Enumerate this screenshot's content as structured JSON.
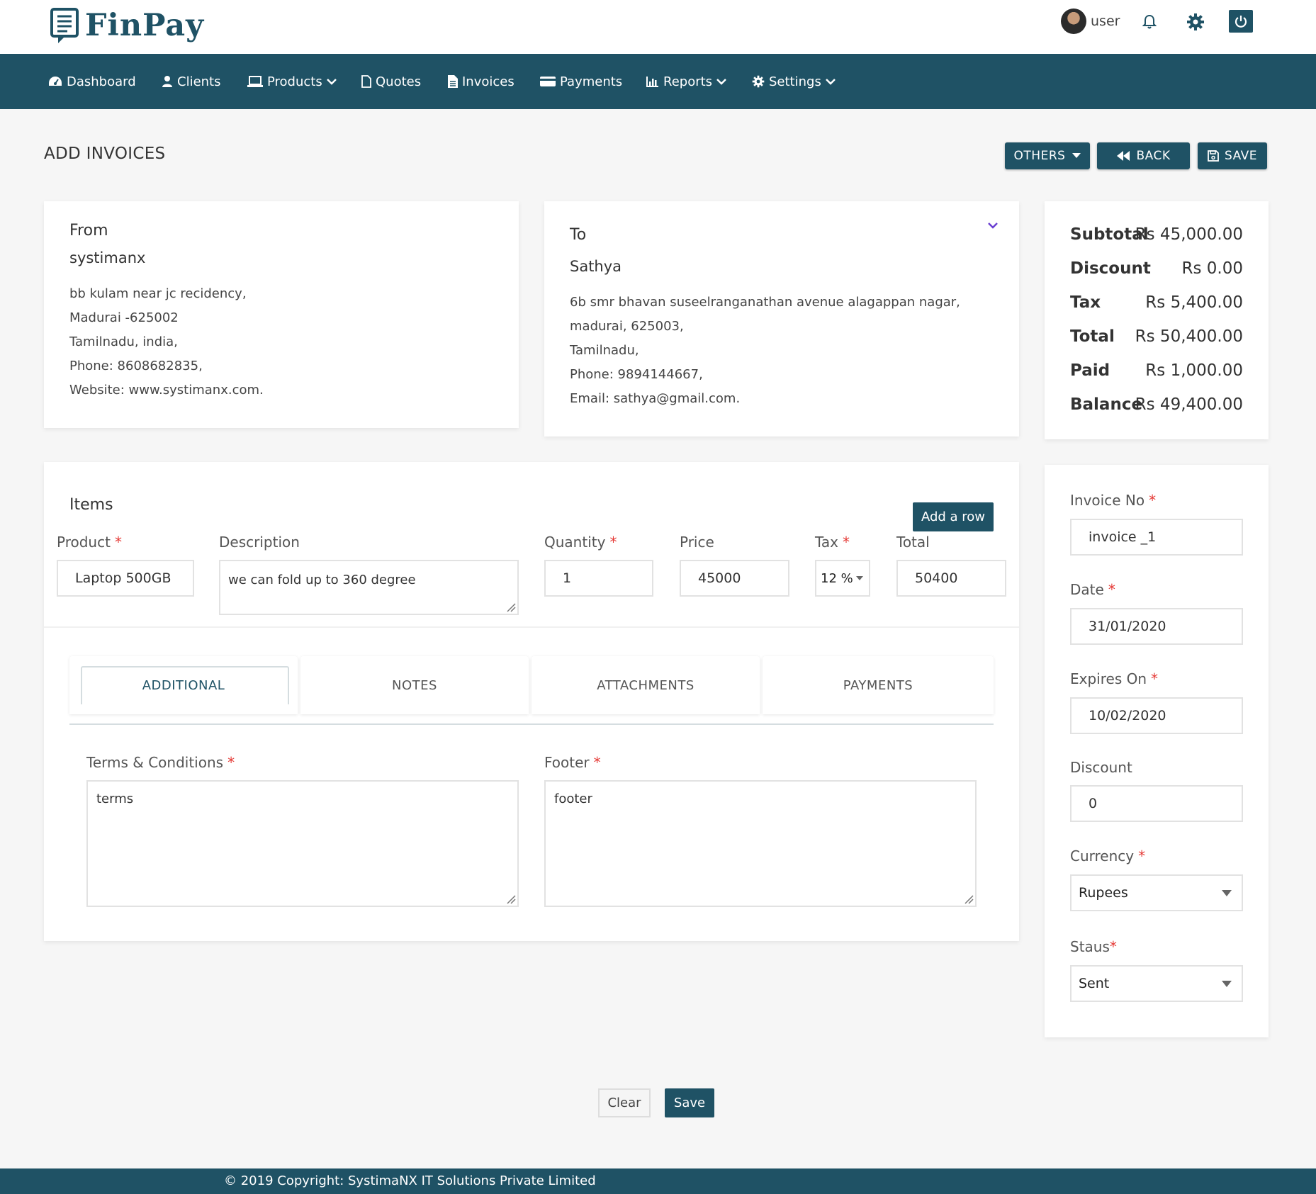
{
  "app": {
    "logo_text": "FinPay"
  },
  "user": {
    "name": "user"
  },
  "colors": {
    "primary": "#1f5265",
    "required": "#e53935",
    "background": "#f6f6f6"
  },
  "nav": {
    "dashboard": "Dashboard",
    "clients": "Clients",
    "products": "Products",
    "quotes": "Quotes",
    "invoices": "Invoices",
    "payments": "Payments",
    "reports": "Reports",
    "settings": "Settings"
  },
  "page": {
    "title": "ADD INVOICES",
    "others_label": "OTHERS",
    "back_label": "BACK",
    "save_label": "SAVE"
  },
  "from": {
    "label": "From",
    "name": "systimanx",
    "lines": [
      "bb kulam near jc recidency,",
      "Madurai -625002",
      "Tamilnadu, india,",
      "Phone: 8608682835,",
      "Website: www.systimanx.com."
    ]
  },
  "to": {
    "label": "To",
    "name": "Sathya",
    "lines": [
      "6b smr bhavan suseelranganathan avenue alagappan nagar,",
      "madurai, 625003,",
      "Tamilnadu,",
      "Phone: 9894144667,",
      "Email: sathya@gmail.com."
    ]
  },
  "summary": {
    "subtotal_label": "Subtotal",
    "subtotal": "Rs 45,000.00",
    "discount_label": "Discount",
    "discount": "Rs 0.00",
    "tax_label": "Tax",
    "tax": "Rs 5,400.00",
    "total_label": "Total",
    "total": "Rs 50,400.00",
    "paid_label": "Paid",
    "paid": "Rs 1,000.00",
    "balance_label": "Balance",
    "balance": "Rs 49,400.00"
  },
  "items": {
    "title": "Items",
    "add_row_label": "Add a row",
    "labels": {
      "product": "Product",
      "description": "Description",
      "quantity": "Quantity",
      "price": "Price",
      "tax": "Tax",
      "total": "Total"
    },
    "row": {
      "product": "Laptop 500GB",
      "description": "we can fold up to 360 degree",
      "quantity": "1",
      "price": "45000",
      "tax": "12 %",
      "total": "50400"
    }
  },
  "tabs": [
    "ADDITIONAL",
    "NOTES",
    "ATTACHMENTS",
    "PAYMENTS"
  ],
  "additional": {
    "terms_label": "Terms & Conditions",
    "terms_value": "terms",
    "footer_label": "Footer",
    "footer_value": "footer"
  },
  "side_form": {
    "invoice_no_label": "Invoice No",
    "invoice_no": "invoice _1",
    "date_label": "Date",
    "date": "31/01/2020",
    "expires_label": "Expires On",
    "expires": "10/02/2020",
    "discount_label": "Discount",
    "discount": "0",
    "currency_label": "Currency",
    "currency": "Rupees",
    "status_label": "Staus",
    "status": "Sent"
  },
  "actions": {
    "clear_label": "Clear",
    "save_label": "Save"
  },
  "footer": {
    "copyright": "© 2019 Copyright: SystimaNX IT Solutions Private Limited"
  },
  "icons": [
    "logo-icon",
    "avatar",
    "bell-icon",
    "gear-icon",
    "power-icon",
    "dashboard-icon",
    "user-icon",
    "laptop-icon",
    "file-icon",
    "file-text-icon",
    "credit-card-icon",
    "bar-chart-icon",
    "chevron-down-icon",
    "caret-down-icon",
    "backward-icon",
    "save-icon",
    "resize-handle-icon"
  ]
}
